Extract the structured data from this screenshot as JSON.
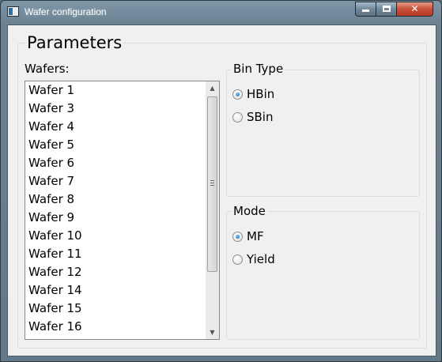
{
  "window": {
    "title": "Wafer configuration",
    "controls": {
      "minimize": "minimize-icon",
      "maximize": "maximize-icon",
      "close": "close-icon",
      "close_glyph": "✕"
    }
  },
  "parameters": {
    "title": "Parameters",
    "wafers": {
      "label": "Wafers:",
      "items": [
        "Wafer 1",
        "Wafer 3",
        "Wafer 4",
        "Wafer 5",
        "Wafer 6",
        "Wafer 7",
        "Wafer 8",
        "Wafer 9",
        "Wafer 10",
        "Wafer 11",
        "Wafer 12",
        "Wafer 14",
        "Wafer 15",
        "Wafer 16"
      ],
      "scroll_up_glyph": "▲",
      "scroll_down_glyph": "▼"
    },
    "bin_type": {
      "title": "Bin Type",
      "options": [
        {
          "label": "HBin",
          "checked": true
        },
        {
          "label": "SBin",
          "checked": false
        }
      ]
    },
    "mode": {
      "title": "Mode",
      "options": [
        {
          "label": "MF",
          "checked": true
        },
        {
          "label": "Yield",
          "checked": false
        }
      ]
    }
  }
}
